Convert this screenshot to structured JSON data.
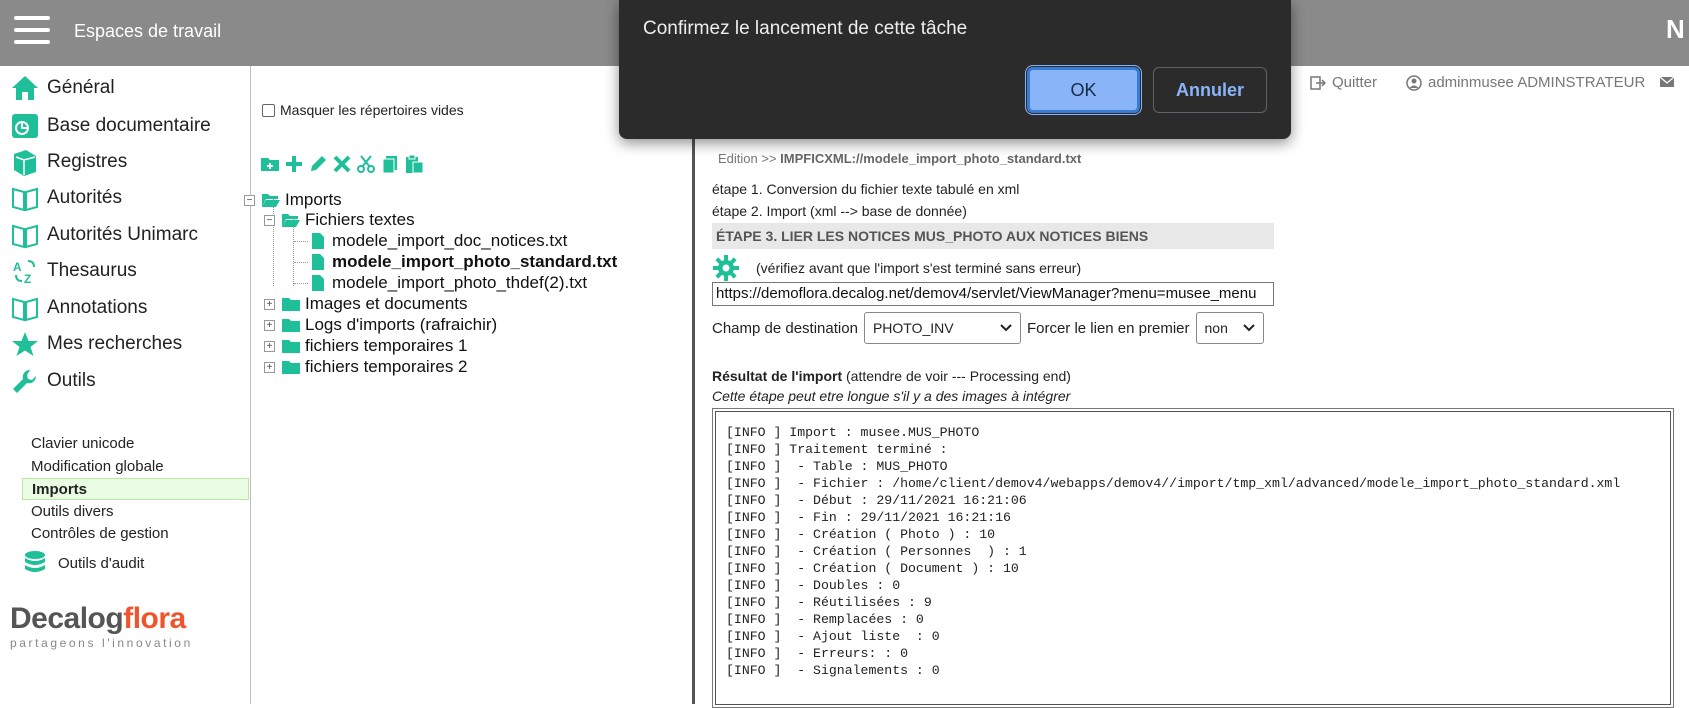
{
  "header": {
    "title": "Espaces de travail",
    "right_letter": "N"
  },
  "sidebar": {
    "menu": [
      {
        "label": "Général",
        "icon": "home-icon"
      },
      {
        "label": "Base documentaire",
        "icon": "document-base-icon"
      },
      {
        "label": "Registres",
        "icon": "registers-icon"
      },
      {
        "label": "Autorités",
        "icon": "book-icon"
      },
      {
        "label": "Autorités Unimarc",
        "icon": "book-icon"
      },
      {
        "label": "Thesaurus",
        "icon": "thesaurus-icon"
      },
      {
        "label": "Annotations",
        "icon": "book-icon"
      },
      {
        "label": "Mes recherches",
        "icon": "star-icon"
      },
      {
        "label": "Outils",
        "icon": "wrench-icon"
      }
    ],
    "submenu": [
      "Clavier unicode",
      "Modification globale",
      "Imports",
      "Outils divers",
      "Contrôles de gestion"
    ],
    "audit_label": "Outils d'audit",
    "logo": {
      "part1": "Decalog",
      "part2": "flora",
      "tagline": "partageons l'innovation"
    }
  },
  "tree": {
    "hide_empty_label": "Masquer les répertoires vides",
    "nodes": {
      "imports": "Imports",
      "fichiers_textes": "Fichiers textes",
      "file1": "modele_import_doc_notices.txt",
      "file2": "modele_import_photo_standard.txt",
      "file3": "modele_import_photo_thdef(2).txt",
      "images": "Images et documents",
      "logs": "Logs d'imports (rafraichir)",
      "tmp1": "fichiers temporaires 1",
      "tmp2": "fichiers temporaires 2"
    },
    "toggles": {
      "minus": "−",
      "plus": "+"
    }
  },
  "main": {
    "quit": "Quitter",
    "user": "adminmusee ADMINSTRATEUR",
    "breadcrumb_prefix": "Edition >> ",
    "breadcrumb_path": "IMPFICXML://modele_import_photo_standard.txt",
    "step1": "étape 1. Conversion du fichier texte tabulé en xml",
    "step2": "étape 2. Import (xml --> base de donnée)",
    "step3": "étape 3. Lier les notices MUS_PHOTO aux notices biens",
    "verify": "(vérifiez avant que l'import s'est terminé sans erreur)",
    "url": "https://demoflora.decalog.net/demov4/servlet/ViewManager?menu=musee_menu",
    "champ_label": "Champ de destination",
    "champ_value": "PHOTO_INV",
    "forcer_label": "Forcer le lien en premier",
    "forcer_value": "non",
    "result_title": "Résultat de l'import",
    "result_hint": " (attendre de voir --- Processing end)",
    "result_sub": "Cette étape peut etre longue s'il y a des images à intégrer",
    "log": "[INFO ] Import : musee.MUS_PHOTO\n[INFO ] Traitement terminé :\n[INFO ]  - Table : MUS_PHOTO\n[INFO ]  - Fichier : /home/client/demov4/webapps/demov4//import/tmp_xml/advanced/modele_import_photo_standard.xml\n[INFO ]  - Début : 29/11/2021 16:21:06\n[INFO ]  - Fin : 29/11/2021 16:21:16\n[INFO ]  - Création ( Photo ) : 10\n[INFO ]  - Création ( Personnes  ) : 1\n[INFO ]  - Création ( Document ) : 10\n[INFO ]  - Doubles : 0\n[INFO ]  - Réutilisées : 9\n[INFO ]  - Remplacées : 0\n[INFO ]  - Ajout liste  : 0\n[INFO ]  - Erreurs: : 0\n[INFO ]  - Signalements : 0"
  },
  "dialog": {
    "message": "Confirmez le lancement de cette tâche",
    "ok": "OK",
    "cancel": "Annuler"
  },
  "colors": {
    "topbar": "#8a8a8a",
    "teal": "#1fbf9a",
    "accent_orange": "#f0542d",
    "dialog_bg": "#2b2b2c",
    "ok_blue": "#8ab4f8"
  }
}
